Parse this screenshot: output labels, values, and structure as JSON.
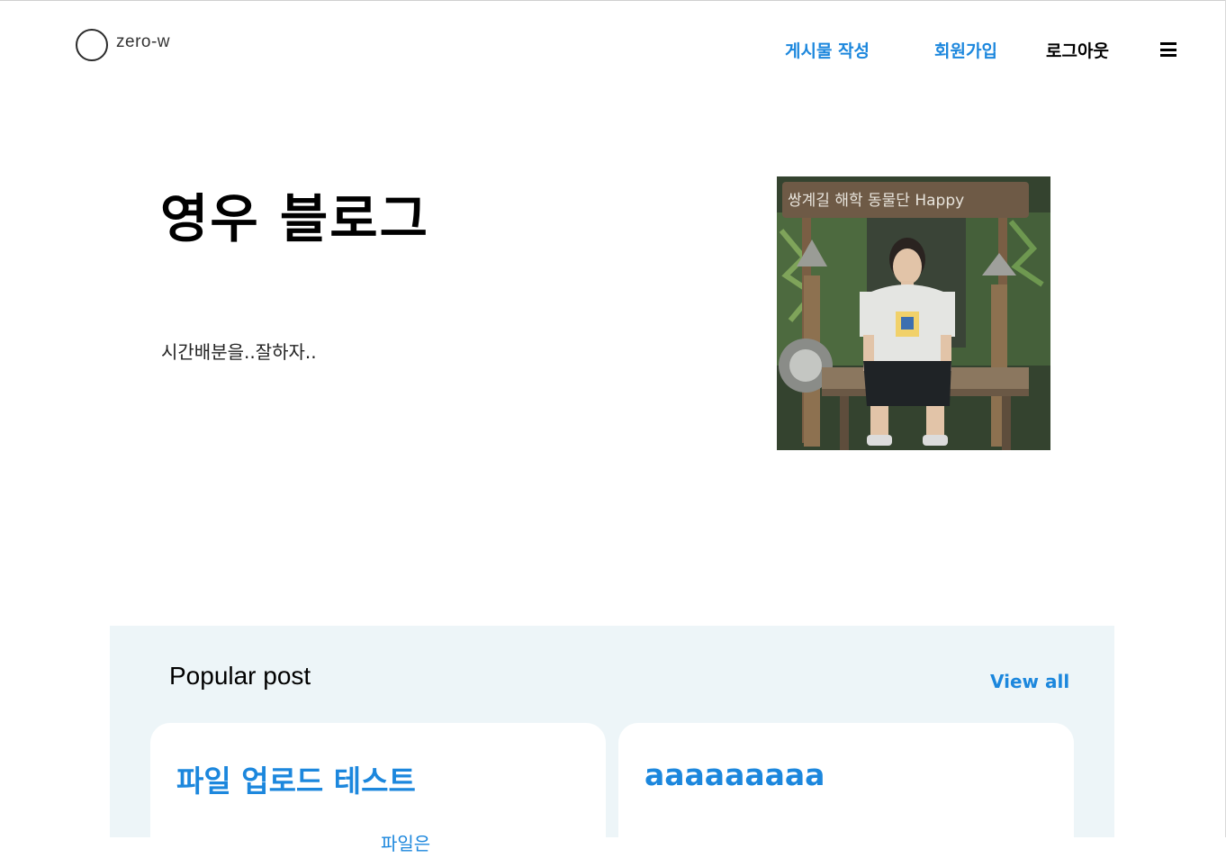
{
  "header": {
    "logo_text": "zero-w",
    "nav": {
      "write_post": "게시물 작성",
      "sign_up": "회원가입",
      "logout": "로그아웃"
    }
  },
  "hero": {
    "title": "영우 블로그",
    "subtitle": "시간배분을..잘하자..",
    "photo_sign_text": "쌍계길 해학 동물단 Happy"
  },
  "popular": {
    "heading": "Popular post",
    "view_all": "View all",
    "posts": [
      {
        "title": "파일 업로드 테스트",
        "meta": "파일은"
      },
      {
        "title": "aaaaaaaaa"
      }
    ]
  },
  "colors": {
    "accent": "#1c87dd",
    "section_bg": "#edf5f8",
    "text": "#000000"
  }
}
